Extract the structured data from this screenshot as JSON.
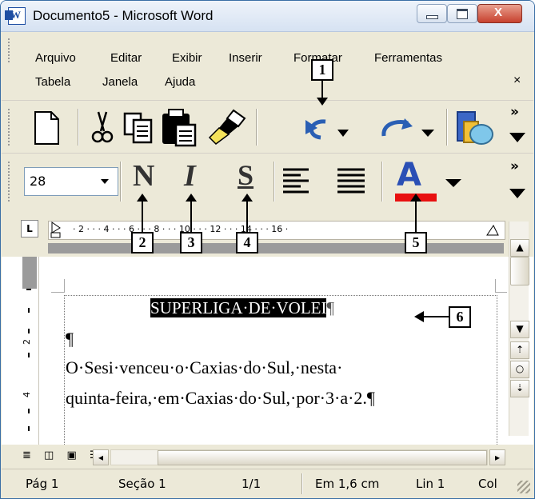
{
  "window": {
    "title": "Documento5 - Microsoft Word"
  },
  "menu": {
    "row1": [
      "Arquivo",
      "Editar",
      "Exibir",
      "Inserir",
      "Formatar",
      "Ferramentas"
    ],
    "row2": [
      "Tabela",
      "Janela",
      "Ajuda"
    ],
    "close_glyph": "×"
  },
  "toolbar": {
    "font_size": "28",
    "bold_letter": "N",
    "italic_letter": "I",
    "underline_letter": "S",
    "font_color_letter": "A",
    "font_color_bar": "#e81010",
    "overflow_glyph": "»"
  },
  "callouts": [
    "1",
    "2",
    "3",
    "4",
    "5",
    "6"
  ],
  "ruler": {
    "tab_stop_glyph": "L",
    "ticks": "· 2 · · · 4 · · · 6 · · · 8 · · · 10 · · · 12 · · · 14 · · · 16 ·"
  },
  "vruler": {
    "labels": [
      "2",
      "4"
    ]
  },
  "document": {
    "selected_title": "SUPERLIGA·DE·VOLEI",
    "title_mark": "¶",
    "empty_paragraph": "¶",
    "line1": "O·Sesi·venceu·o·Caxias·do·Sul,·nesta·",
    "line2": "quinta-feira,·em·Caxias·do·Sul,·por·3·a·2.¶"
  },
  "status": {
    "page": "Pág 1",
    "section": "Seção 1",
    "pages": "1/1",
    "position": "Em 1,6 cm",
    "line": "Lin 1",
    "column": "Col"
  }
}
